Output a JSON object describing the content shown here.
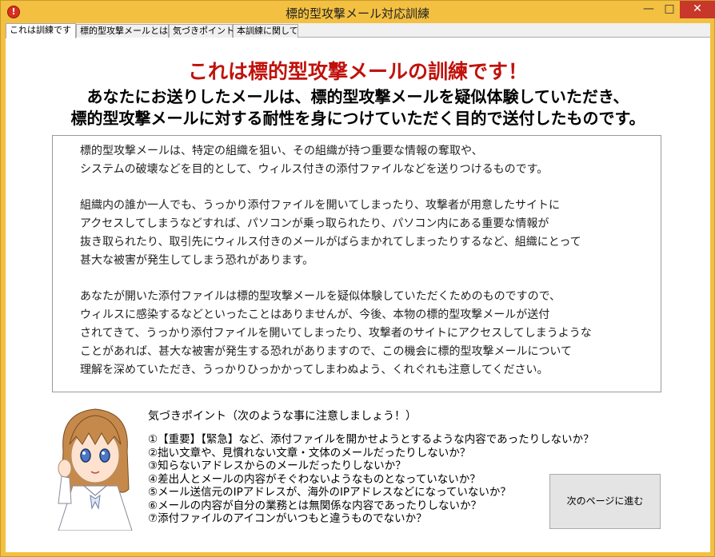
{
  "window": {
    "title": "標的型攻撃メール対応訓練",
    "icon": "alert-icon",
    "controls": {
      "minimize": "—",
      "maximize": "□",
      "close": "✕"
    },
    "accent": "#f3c041",
    "close_color": "#c7372a"
  },
  "tabs": [
    {
      "label": "これは訓練です",
      "active": true
    },
    {
      "label": "標的型攻撃メールとは",
      "active": false
    },
    {
      "label": "気づきポイント",
      "active": false
    },
    {
      "label": "本訓練に関して",
      "active": false
    }
  ],
  "main": {
    "headline": "これは標的型攻撃メールの訓練です！",
    "headline_color": "#c0120c",
    "subtitle_line1": "あなたにお送りしたメールは、標的型攻撃メールを疑似体験していただき、",
    "subtitle_line2": "標的型攻撃メールに対する耐性を身につけていただく目的で送付したものです。",
    "paragraphs": [
      [
        "標的型攻撃メールは、特定の組織を狙い、その組織が持つ重要な情報の奪取や、",
        "システムの破壊などを目的として、ウィルス付きの添付ファイルなどを送りつけるものです。"
      ],
      [
        "組織内の誰か一人でも、うっかり添付ファイルを開いてしまったり、攻撃者が用意したサイトに",
        "アクセスしてしまうなどすれば、パソコンが乗っ取られたり、パソコン内にある重要な情報が",
        "抜き取られたり、取引先にウィルス付きのメールがばらまかれてしまったりするなど、組織にとって",
        "甚大な被害が発生してしまう恐れがあります。"
      ],
      [
        "あなたが開いた添付ファイルは標的型攻撃メールを疑似体験していただくためのものですので、",
        "ウィルスに感染するなどといったことはありませんが、今後、本物の標的型攻撃メールが送付",
        "されてきて、うっかり添付ファイルを開いてしまったり、攻撃者のサイトにアクセスしてしまうような",
        "ことがあれば、甚大な被害が発生する恐れがありますので、この機会に標的型攻撃メールについて",
        "理解を深めていただき、うっかりひっかかってしまわぬよう、くれぐれも注意してください。"
      ]
    ]
  },
  "tips": {
    "title": "気づきポイント（次のような事に注意しましょう！）",
    "items": [
      "①【重要】【緊急】など、添付ファイルを開かせようとするような内容であったりしないか？",
      "②拙い文章や、見慣れない文章・文体のメールだったりしないか？",
      "③知らないアドレスからのメールだったりしないか？",
      "④差出人とメールの内容がそぐわないようなものとなっていないか？",
      "⑤メール送信元のIPアドレスが、海外のIPアドレスなどになっていないか？",
      "⑥メールの内容が自分の業務とは無関係な内容であったりしないか？",
      "⑦添付ファイルのアイコンがいつもと違うものでないか？"
    ]
  },
  "next_button": {
    "label": "次のページに進む"
  },
  "avatar": {
    "icon": "mascot-girl-illustration"
  }
}
